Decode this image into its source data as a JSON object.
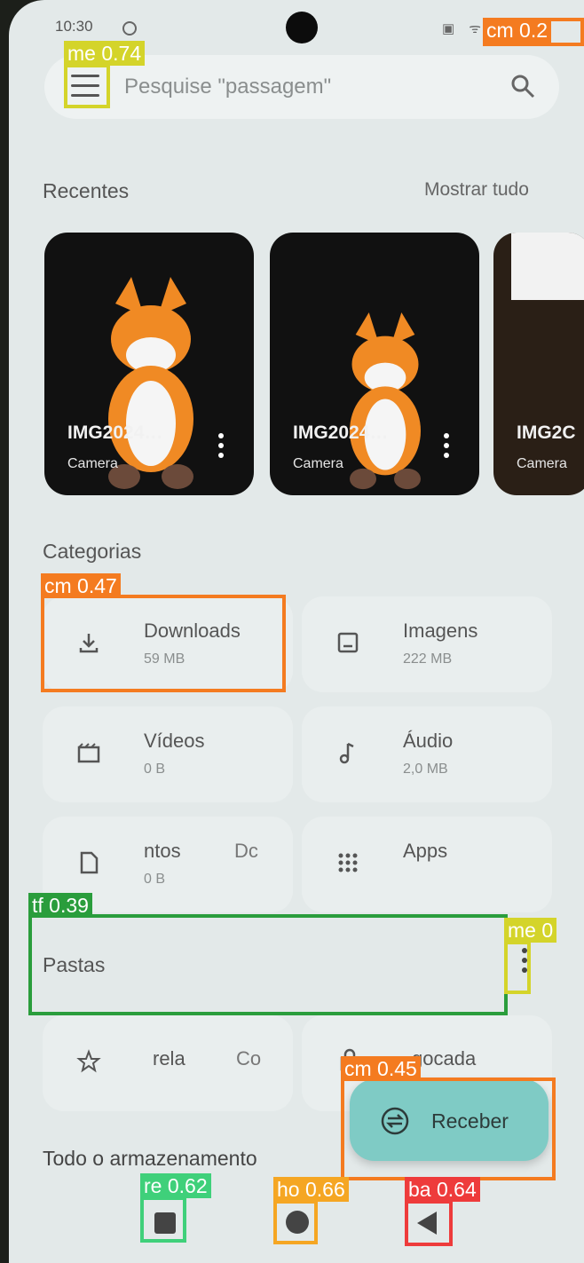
{
  "status_bar": {
    "time": "10:30",
    "right_icons": "▣ ᯤ"
  },
  "search": {
    "placeholder": "Pesquise \"passagem\""
  },
  "recents": {
    "title": "Recentes",
    "show_all": "Mostrar tudo",
    "items": [
      {
        "name": "IMG2024…",
        "source": "Camera"
      },
      {
        "name": "IMG2024…",
        "source": "Camera"
      },
      {
        "name": "IMG2C",
        "source": "Camera"
      }
    ]
  },
  "categories": {
    "title": "Categorias",
    "items": [
      {
        "name": "Downloads",
        "size": "59 MB",
        "icon": "download-icon"
      },
      {
        "name": "Imagens",
        "size": "222 MB",
        "icon": "image-icon"
      },
      {
        "name": "Vídeos",
        "size": "0 B",
        "icon": "video-icon"
      },
      {
        "name": "Áudio",
        "size": "2,0 MB",
        "icon": "music-note-icon"
      },
      {
        "name": "ntos",
        "name_extra": "Dc",
        "size": "0 B",
        "icon": "document-icon"
      },
      {
        "name": "Apps",
        "size": "",
        "icon": "apps-grid-icon"
      },
      {
        "name": "rela",
        "name_extra": "Co",
        "size": "",
        "icon": "star-icon"
      },
      {
        "name": "gocada",
        "size": "",
        "icon": "lock-icon"
      }
    ]
  },
  "folders": {
    "title": "Pastas"
  },
  "fab": {
    "label": "Receber"
  },
  "storage": {
    "title": "Todo o armazenamento"
  },
  "detections": [
    {
      "label": "cm 0.2",
      "color": "#f47b20"
    },
    {
      "label": "me 0.74",
      "color": "#d4d42a"
    },
    {
      "label": "cm 0.47",
      "color": "#f47b20"
    },
    {
      "label": "tf 0.39",
      "color": "#2a9d3c"
    },
    {
      "label": "me 0",
      "color": "#d4d42a"
    },
    {
      "label": "cm 0.45",
      "color": "#f47b20"
    },
    {
      "label": "re 0.62",
      "color": "#3fd07a"
    },
    {
      "label": "ho 0.66",
      "color": "#f5a623"
    },
    {
      "label": "ba 0.64",
      "color": "#ee3b3b"
    }
  ]
}
